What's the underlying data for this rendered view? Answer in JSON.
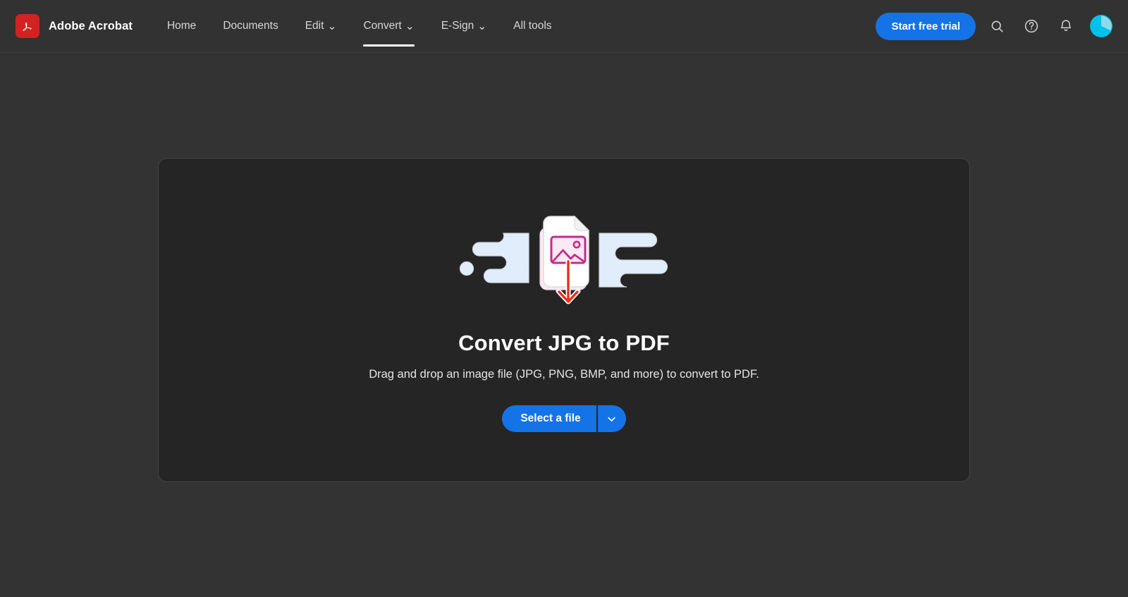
{
  "header": {
    "brand": {
      "name": "Adobe Acrobat",
      "logo_icon": "adobe-acrobat-logo-icon",
      "logo_color": "#D42121"
    },
    "nav_items": [
      {
        "label": "Home",
        "has_caret": false,
        "active": false
      },
      {
        "label": "Documents",
        "has_caret": false,
        "active": false
      },
      {
        "label": "Edit",
        "has_caret": true,
        "caret_glyph": "⌄",
        "active": false
      },
      {
        "label": "Convert",
        "has_caret": true,
        "caret_glyph": "⌄",
        "active": true
      },
      {
        "label": "E-Sign",
        "has_caret": true,
        "caret_glyph": "⌄",
        "active": false
      },
      {
        "label": "All tools",
        "has_caret": false,
        "active": false
      }
    ],
    "trial_button_label": "Start free trial",
    "trial_button_color": "#1473E6",
    "icons": [
      {
        "name": "search-icon"
      },
      {
        "name": "help-icon"
      },
      {
        "name": "notifications-bell-icon"
      }
    ],
    "avatar": {
      "name": "user-avatar",
      "color": "#00C2EA",
      "wedge_color": "#8FD9E8"
    }
  },
  "main": {
    "dropzone": {
      "title": "Convert JPG to PDF",
      "subtitle": "Drag and drop an image file (JPG, PNG, BMP, and more) to convert to PDF.",
      "illustration_name": "jpg-to-pdf-illustration",
      "illustration_colors": {
        "shapes": "#E2EDFB",
        "document": "#FFFFFF",
        "document_shadow": "#FBE9F1",
        "image_icon": "#C9298A",
        "arrow": "#E8301A"
      },
      "select_file_label": "Select a file",
      "select_file_dropdown_icon": "chevron-down-icon",
      "button_color": "#1473E6"
    },
    "background_color": "#333333",
    "dropzone_background_color": "#252525"
  }
}
